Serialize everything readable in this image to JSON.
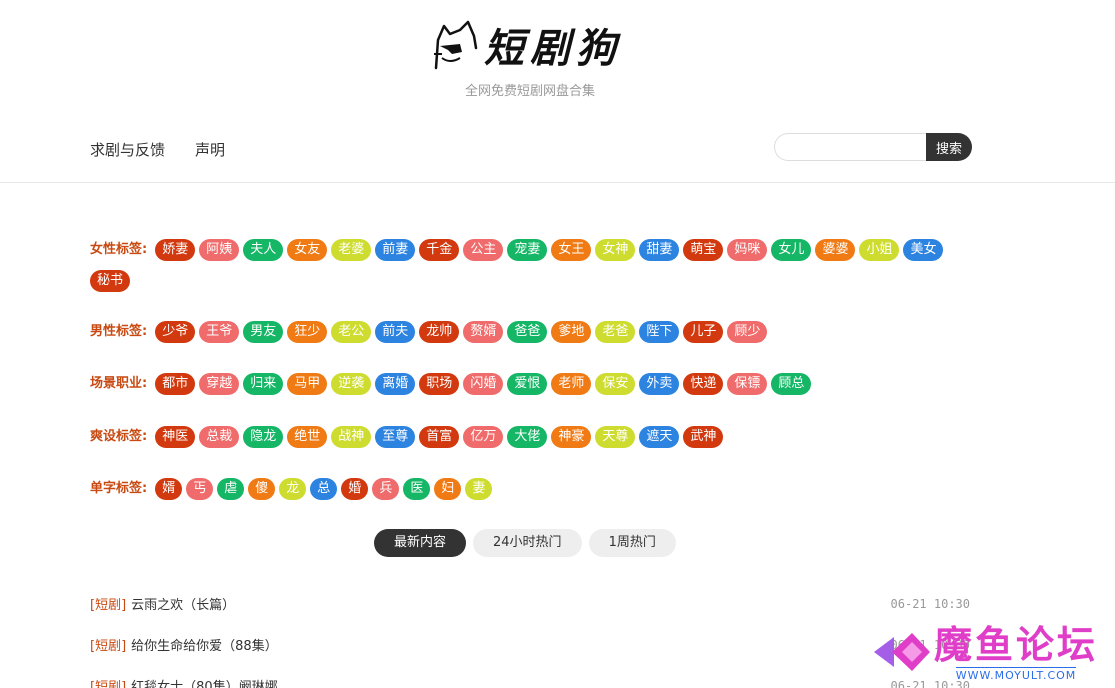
{
  "site": {
    "logo_title": "短剧狗",
    "subtitle": "全网免费短剧网盘合集"
  },
  "nav": {
    "items": [
      "求剧与反馈",
      "声明"
    ]
  },
  "search": {
    "placeholder": "",
    "button_label": "搜索"
  },
  "tag_groups": [
    {
      "label": "女性标签:",
      "tags": [
        "娇妻",
        "阿姨",
        "夫人",
        "女友",
        "老婆",
        "前妻",
        "千金",
        "公主",
        "宠妻",
        "女王",
        "女神",
        "甜妻",
        "萌宝",
        "妈咪",
        "女儿",
        "婆婆",
        "小姐",
        "美女",
        "秘书"
      ]
    },
    {
      "label": "男性标签:",
      "tags": [
        "少爷",
        "王爷",
        "男友",
        "狂少",
        "老公",
        "前夫",
        "龙帅",
        "赘婿",
        "爸爸",
        "爹地",
        "老爸",
        "陛下",
        "儿子",
        "顾少"
      ]
    },
    {
      "label": "场景职业:",
      "tags": [
        "都市",
        "穿越",
        "归来",
        "马甲",
        "逆袭",
        "离婚",
        "职场",
        "闪婚",
        "爱恨",
        "老师",
        "保安",
        "外卖",
        "快递",
        "保镖",
        "顾总"
      ]
    },
    {
      "label": "爽设标签:",
      "tags": [
        "神医",
        "总裁",
        "隐龙",
        "绝世",
        "战神",
        "至尊",
        "首富",
        "亿万",
        "大佬",
        "神豪",
        "天尊",
        "遮天",
        "武神"
      ]
    },
    {
      "label": "单字标签:",
      "tags": [
        "婿",
        "丐",
        "虐",
        "傻",
        "龙",
        "总",
        "婚",
        "兵",
        "医",
        "妇",
        "妻"
      ]
    }
  ],
  "tag_colors": [
    "#d2390f",
    "#f06b6b",
    "#15b665",
    "#f07a14",
    "#cddc2e",
    "#2c83e0"
  ],
  "tabs": [
    "最新内容",
    "24小时热门",
    "1周热门"
  ],
  "list": [
    {
      "category": "[短剧]",
      "title": "云雨之欢（长篇）",
      "time": "06-21 10:30"
    },
    {
      "category": "[短剧]",
      "title": "给你生命给你爱（88集）",
      "time": "06-21 10:30"
    },
    {
      "category": "[短剧]",
      "title": "红毯女士（80集）阚琳娜",
      "time": "06-21 10:30"
    }
  ],
  "watermark": {
    "title": "魔鱼论坛",
    "url": "WWW.MOYULT.COM"
  }
}
